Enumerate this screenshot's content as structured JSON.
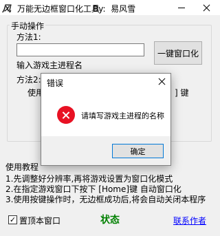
{
  "window": {
    "icon_glyph": "风",
    "icon": "app-logo-icon",
    "title": "万能无边框窗口化工具",
    "author": "By:  易风雪"
  },
  "manual": {
    "group_title": "手动操作",
    "method1_label": "方法1:",
    "input_value": "",
    "input_hint": "输入游戏主进程名",
    "oneclick_label": "一键窗口化",
    "method2_label": "方法2:",
    "method2_line_start": "使用",
    "method2_line_end": "] 键"
  },
  "help": {
    "title": "使用教程",
    "lines": [
      "1.先调整好分辨率,再将游戏设置为窗口化模式",
      "2.在指定游戏窗口下按下 [Home]键 自动窗口化",
      "3.使用按键操作时，无边框成功后,将会自动关闭本程序"
    ]
  },
  "footer": {
    "topmost_label": "置顶本窗口",
    "topmost_checked": "✓",
    "status": "状态",
    "contact": "联系作者"
  },
  "dialog": {
    "title": "错误",
    "message": "请填写游戏主进程的名称",
    "ok_label": "确定",
    "icon": "error-icon"
  },
  "colors": {
    "status": "#008000",
    "link": "#0000ff",
    "error": "#e81123",
    "focus_border": "#0078d7"
  }
}
